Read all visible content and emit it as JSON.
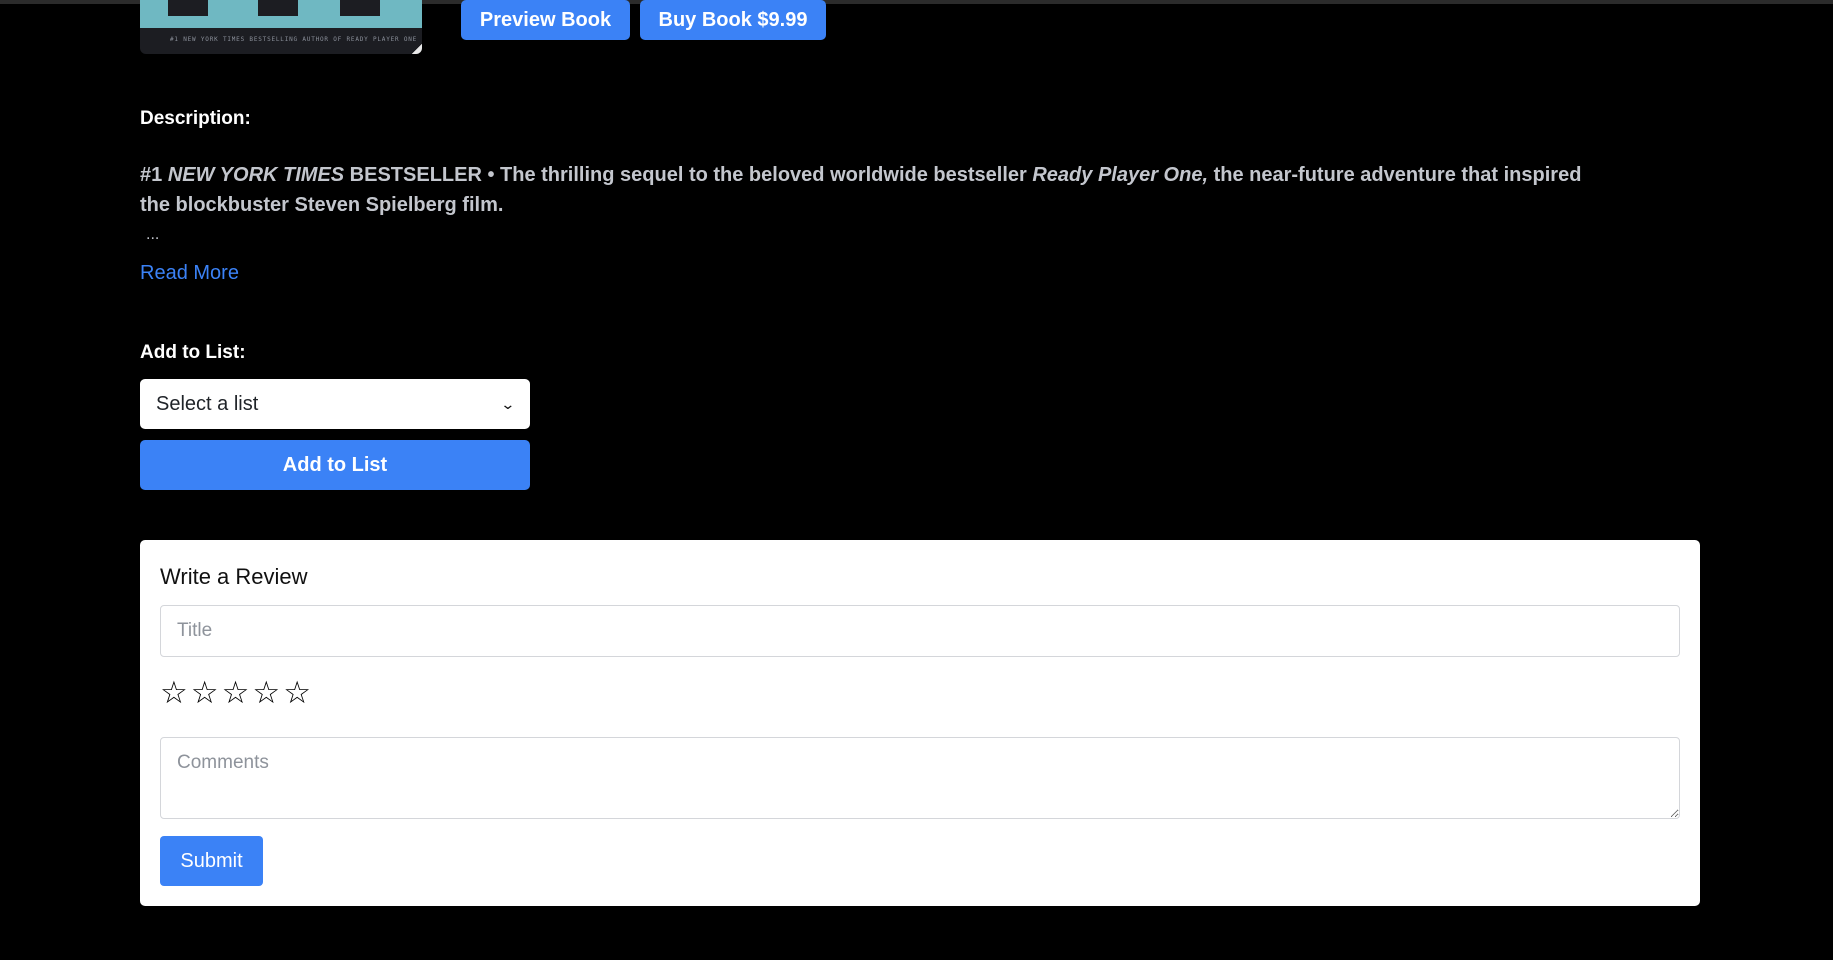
{
  "book": {
    "cover_tagline": "#1 NEW YORK TIMES BESTSELLING AUTHOR OF READY PLAYER ONE",
    "preview_label": "Preview Book",
    "buy_label": "Buy Book $9.99"
  },
  "description": {
    "heading": "Description:",
    "part1": "#1 ",
    "part2_italic": "NEW YORK TIMES",
    "part3": " BESTSELLER • The thrilling sequel to the beloved worldwide bestseller ",
    "part4_italic": "Ready Player One,",
    "part5": " the near-future adventure that inspired the blockbuster Steven Spielberg film.",
    "ellipsis": "...",
    "read_more": "Read More"
  },
  "add_to_list": {
    "heading": "Add to List:",
    "select_value": "Select a list",
    "button_label": "Add to List"
  },
  "review": {
    "heading": "Write a Review",
    "title_placeholder": "Title",
    "stars": [
      "☆",
      "☆",
      "☆",
      "☆",
      "☆"
    ],
    "rating": 0,
    "comments_placeholder": "Comments",
    "submit_label": "Submit"
  },
  "colors": {
    "accent": "#3b82f6",
    "background": "#000000",
    "card": "#ffffff"
  }
}
